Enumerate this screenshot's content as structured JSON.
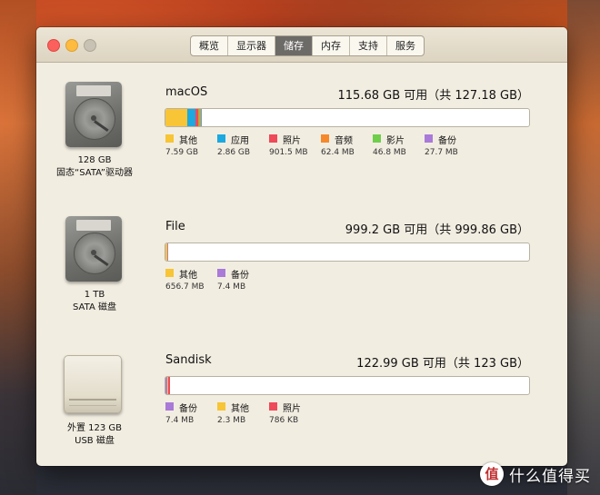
{
  "tabs": [
    {
      "label": "概览"
    },
    {
      "label": "显示器"
    },
    {
      "label": "储存"
    },
    {
      "label": "内存"
    },
    {
      "label": "支持"
    },
    {
      "label": "服务"
    }
  ],
  "active_tab": "储存",
  "colors": {
    "其他": "#f7c535",
    "应用": "#1ba9e0",
    "照片": "#ee4a5a",
    "音频": "#f5882a",
    "影片": "#6fce4c",
    "备份": "#a97ad8"
  },
  "drives": [
    {
      "icon": "hard-drive-icon",
      "caption_line1": "128 GB",
      "caption_line2": "固态“SATA”驱动器",
      "volume_name": "macOS",
      "free_text": "115.68 GB 可用（共 127.18 GB）",
      "usage": [
        {
          "name": "其他",
          "size": "7.59 GB",
          "fraction": 0.06
        },
        {
          "name": "应用",
          "size": "2.86 GB",
          "fraction": 0.022
        },
        {
          "name": "照片",
          "size": "901.5 MB",
          "fraction": 0.007
        },
        {
          "name": "音频",
          "size": "62.4 MB",
          "fraction": 0.003
        },
        {
          "name": "影片",
          "size": "46.8 MB",
          "fraction": 0.002
        },
        {
          "name": "备份",
          "size": "27.7 MB",
          "fraction": 0.002
        }
      ]
    },
    {
      "icon": "hard-drive-icon",
      "caption_line1": "1 TB",
      "caption_line2": "SATA 磁盘",
      "volume_name": "File",
      "free_text": "999.2 GB 可用（共 999.86 GB）",
      "usage": [
        {
          "name": "其他",
          "size": "656.7 MB",
          "fraction": 0.001
        },
        {
          "name": "备份",
          "size": "7.4 MB",
          "fraction": 0.003
        }
      ]
    },
    {
      "icon": "usb-drive-icon",
      "caption_line1": "外置 123 GB",
      "caption_line2": "USB 磁盘",
      "volume_name": "Sandisk",
      "free_text": "122.99 GB 可用（共 123 GB）",
      "usage": [
        {
          "name": "备份",
          "size": "7.4 MB",
          "fraction": 0.001
        },
        {
          "name": "其他",
          "size": "2.3 MB",
          "fraction": 0.001
        },
        {
          "name": "照片",
          "size": "786 KB",
          "fraction": 0.006
        }
      ]
    }
  ],
  "watermark": {
    "logo": "值",
    "text": "什么值得买"
  }
}
